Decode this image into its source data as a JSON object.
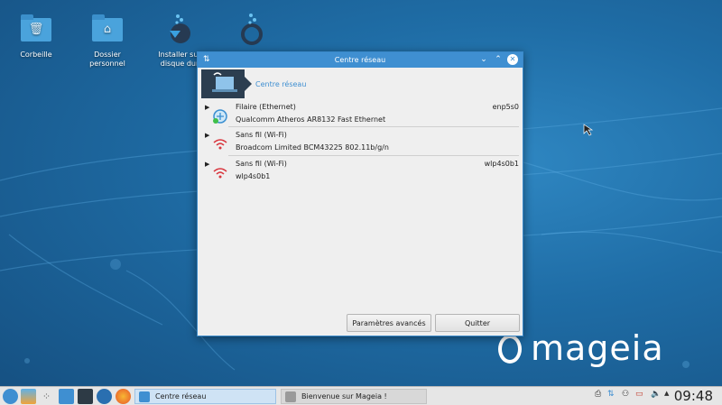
{
  "desktop": {
    "icons": [
      {
        "label": "Corbeille"
      },
      {
        "label": "Dossier\npersonnel"
      },
      {
        "label": "Installer sur\ndisque dur"
      },
      {
        "label": ""
      }
    ],
    "brand": "mageia"
  },
  "window": {
    "title": "Centre réseau",
    "header_title": "Centre réseau",
    "connections": [
      {
        "type": "Filaire (Ethernet)",
        "device": "enp5s0",
        "description": "Qualcomm Atheros AR8132 Fast Ethernet",
        "icon": "ethernet-icon"
      },
      {
        "type": "Sans fil (Wi-Fi)",
        "device": "",
        "description": "Broadcom Limited BCM43225 802.11b/g/n",
        "icon": "wifi-icon"
      },
      {
        "type": "Sans fil (Wi-Fi)",
        "device": "wlp4s0b1",
        "description": "wlp4s0b1",
        "icon": "wifi-icon"
      }
    ],
    "buttons": {
      "advanced": "Paramètres avancés",
      "quit": "Quitter"
    }
  },
  "taskbar": {
    "tasks": [
      {
        "label": "Centre réseau"
      },
      {
        "label": "Bienvenue sur Mageia !"
      }
    ],
    "clock": "09:48"
  },
  "colors": {
    "accent": "#3f8fd1",
    "desktop": "#1f6da6"
  }
}
